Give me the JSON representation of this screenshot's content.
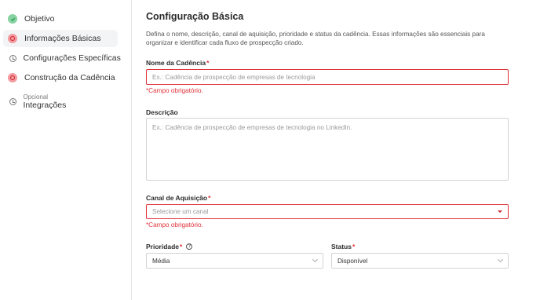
{
  "sidebar": {
    "items": [
      {
        "label": "Objetivo",
        "icon": "check-circle-icon",
        "state": "done"
      },
      {
        "label": "Informações Básicas",
        "icon": "error-circle-icon",
        "state": "error"
      },
      {
        "label": "Configurações Específicas",
        "icon": "clock-icon",
        "state": "pending"
      },
      {
        "label": "Construção da Cadência",
        "icon": "error-circle-icon",
        "state": "error"
      },
      {
        "label": "Integrações",
        "optional": "Opcional",
        "icon": "clock-icon",
        "state": "pending"
      }
    ]
  },
  "form": {
    "title": "Configuração Básica",
    "description": "Defina o nome, descrição, canal de aquisição, prioridade e status da cadência. Essas informações são essenciais para organizar e identificar cada fluxo de prospecção criado.",
    "name": {
      "label": "Nome da Cadência",
      "required": "*",
      "placeholder": "Ex.: Cadência de prospecção de empresas de tecnologia",
      "error": "*Campo obrigatório."
    },
    "description_field": {
      "label": "Descrição",
      "placeholder": "Ex.: Cadência de prospecção de empresas de tecnologia no LinkedIn."
    },
    "channel": {
      "label": "Canal de Aquisição",
      "required": "*",
      "placeholder": "Selecione um canal",
      "error": "*Campo obrigatório."
    },
    "priority": {
      "label": "Prioridade",
      "required": "*",
      "help_icon": "?",
      "value": "Média"
    },
    "status": {
      "label": "Status",
      "required": "*",
      "value": "Disponível"
    }
  },
  "colors": {
    "error": "#e0323a",
    "done": "#86d3a0",
    "error_icon_bg": "#f39a9f"
  }
}
